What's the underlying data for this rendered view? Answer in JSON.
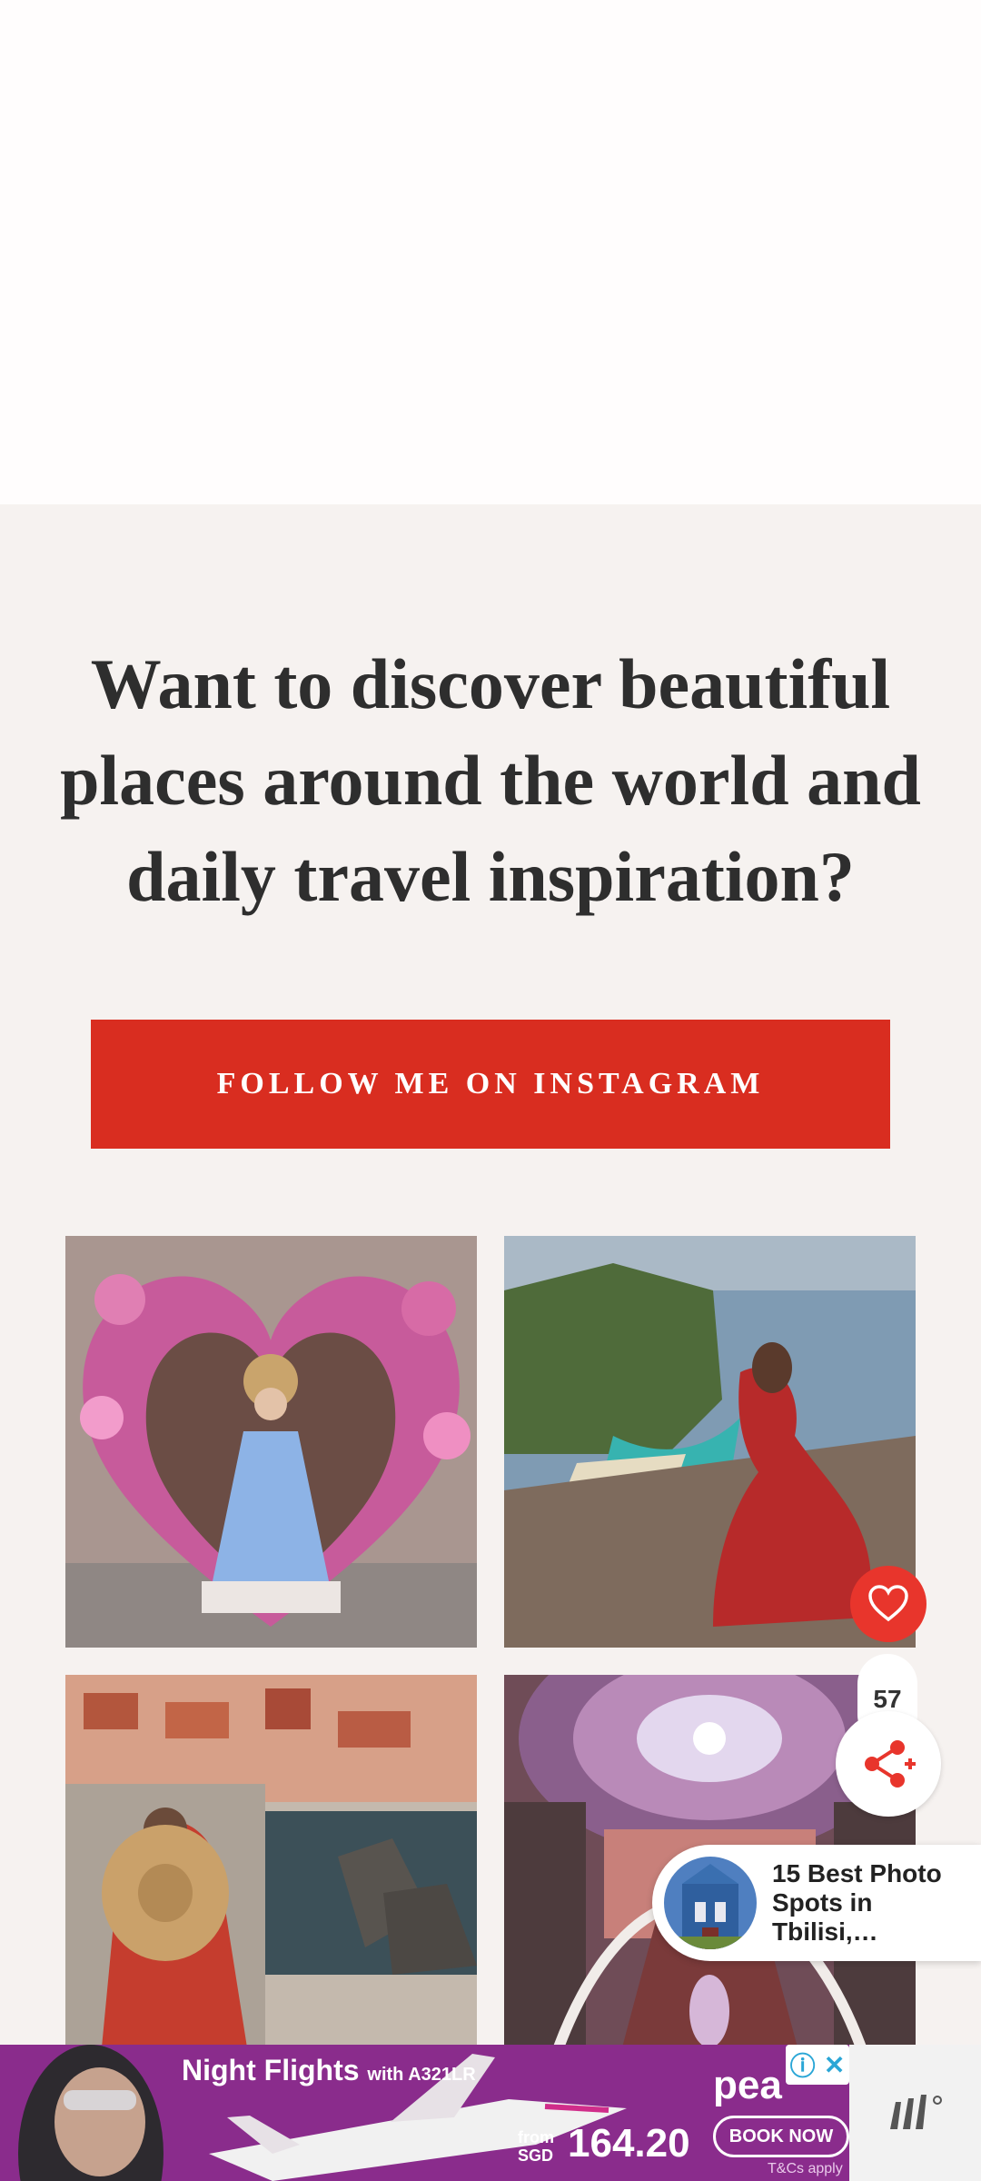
{
  "headline": "Want to discover beautiful places around the world and daily travel inspiration?",
  "cta_label": "FOLLOW ME ON INSTAGRAM",
  "share_count": "57",
  "related": {
    "title": "15 Best Photo Spots in Tbilisi,…"
  },
  "ad": {
    "title": "Night Flights",
    "subtitle": "with A321LR",
    "brand": "pea",
    "from_label": "from",
    "currency": "SGD",
    "price": "164.20",
    "book_label": "BOOK NOW",
    "tcs": "T&Cs apply"
  },
  "colors": {
    "accent": "#d92d20",
    "like": "#e8352c",
    "ad_bg": "#8a2c8c"
  },
  "icons": {
    "like": "heart-icon",
    "share": "share-icon",
    "ad_info": "adchoices-icon",
    "ad_close": "close-icon",
    "corner": "mediavine-logo-icon"
  }
}
